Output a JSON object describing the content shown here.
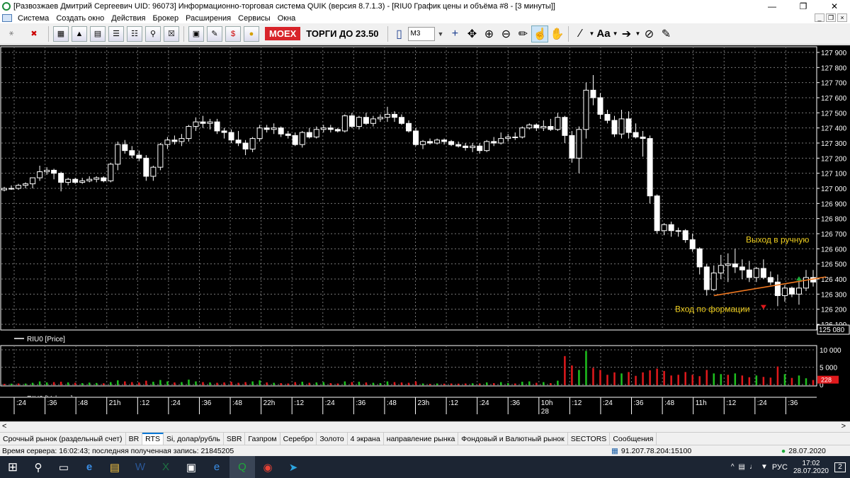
{
  "window": {
    "title": "[Развозжаев Дмитрий Сергеевич UID: 96073] Информационно-торговая система QUIK (версия 8.7.1.3) - [RIU0 График цены и объёма #8 - [3 минуты]]"
  },
  "menu": [
    "Система",
    "Создать окно",
    "Действия",
    "Брокер",
    "Расширения",
    "Сервисы",
    "Окна"
  ],
  "toolbar": {
    "exchange": "MOEX",
    "session": "ТОРГИ ДО 23.50",
    "interval": "M3",
    "font_btn": "Aa"
  },
  "price_axis": {
    "labels": [
      "127 900",
      "127 800",
      "127 700",
      "127 600",
      "127 500",
      "127 400",
      "127 300",
      "127 200",
      "127 100",
      "127 000",
      "126 900",
      "126 800",
      "126 700",
      "126 600",
      "126 500",
      "126 400",
      "126 300",
      "126 200",
      "126 100"
    ],
    "last_price": "125 080"
  },
  "volume_axis": {
    "labels": [
      "10 000",
      "5 000",
      "0"
    ],
    "last_volume": "228"
  },
  "legends": {
    "price": "RIU0 [Price]",
    "volume": "RIU0 [Volume]"
  },
  "annotations": {
    "exit": "Выход в ручную",
    "entry": "Вход по формации"
  },
  "time_axis": {
    "labels": [
      ":24",
      ":36",
      ":48",
      "21h",
      ":12",
      ":24",
      ":36",
      ":48",
      "22h",
      ":12",
      ":24",
      ":36",
      ":48",
      "23h",
      ":12",
      ":24",
      ":36",
      "10h",
      ":12",
      ":24",
      ":36",
      ":48",
      "11h",
      ":12",
      ":24",
      ":36"
    ],
    "day": "28"
  },
  "chart_data": {
    "type": "candlestick",
    "interval": "3 минуты",
    "instrument": "RIU0",
    "ylim": [
      126100,
      127900
    ],
    "candles": [
      [
        126990,
        127010,
        126980,
        127000
      ],
      [
        127000,
        127020,
        126990,
        127000
      ],
      [
        127000,
        127030,
        126990,
        127020
      ],
      [
        127020,
        127040,
        127000,
        127030
      ],
      [
        127030,
        127070,
        127000,
        127070
      ],
      [
        127070,
        127150,
        127050,
        127110
      ],
      [
        127110,
        127140,
        127090,
        127120
      ],
      [
        127120,
        127130,
        127060,
        127100
      ],
      [
        127100,
        127110,
        126980,
        127040
      ],
      [
        127040,
        127070,
        127020,
        127060
      ],
      [
        127060,
        127070,
        127030,
        127040
      ],
      [
        127040,
        127070,
        127030,
        127050
      ],
      [
        127050,
        127080,
        127040,
        127060
      ],
      [
        127060,
        127080,
        127040,
        127070
      ],
      [
        127070,
        127080,
        127040,
        127050
      ],
      [
        127050,
        127170,
        127040,
        127160
      ],
      [
        127160,
        127310,
        127120,
        127290
      ],
      [
        127290,
        127320,
        127230,
        127250
      ],
      [
        127250,
        127280,
        127200,
        127220
      ],
      [
        127220,
        127250,
        127180,
        127200
      ],
      [
        127200,
        127220,
        127050,
        127080
      ],
      [
        127080,
        127150,
        127050,
        127140
      ],
      [
        127140,
        127300,
        127120,
        127290
      ],
      [
        127290,
        127340,
        127260,
        127320
      ],
      [
        127320,
        127350,
        127290,
        127310
      ],
      [
        127310,
        127360,
        127280,
        127330
      ],
      [
        127330,
        127420,
        127310,
        127410
      ],
      [
        127410,
        127470,
        127380,
        127440
      ],
      [
        127440,
        127480,
        127400,
        127430
      ],
      [
        127430,
        127460,
        127390,
        127440
      ],
      [
        127440,
        127460,
        127360,
        127380
      ],
      [
        127380,
        127400,
        127330,
        127370
      ],
      [
        127370,
        127390,
        127300,
        127320
      ],
      [
        127320,
        127380,
        127280,
        127300
      ],
      [
        127300,
        127320,
        127220,
        127260
      ],
      [
        127260,
        127340,
        127240,
        127330
      ],
      [
        127330,
        127420,
        127310,
        127400
      ],
      [
        127400,
        127420,
        127370,
        127390
      ],
      [
        127390,
        127430,
        127360,
        127400
      ],
      [
        127400,
        127410,
        127340,
        127360
      ],
      [
        127360,
        127380,
        127330,
        127350
      ],
      [
        127350,
        127370,
        127280,
        127290
      ],
      [
        127290,
        127380,
        127270,
        127370
      ],
      [
        127370,
        127400,
        127330,
        127340
      ],
      [
        127340,
        127410,
        127330,
        127390
      ],
      [
        127390,
        127420,
        127370,
        127400
      ],
      [
        127400,
        127420,
        127370,
        127390
      ],
      [
        127390,
        127400,
        127370,
        127380
      ],
      [
        127380,
        127490,
        127370,
        127480
      ],
      [
        127480,
        127500,
        127400,
        127410
      ],
      [
        127410,
        127480,
        127390,
        127470
      ],
      [
        127470,
        127500,
        127420,
        127430
      ],
      [
        127430,
        127480,
        127410,
        127460
      ],
      [
        127460,
        127490,
        127440,
        127470
      ],
      [
        127470,
        127540,
        127440,
        127490
      ],
      [
        127490,
        127510,
        127440,
        127470
      ],
      [
        127470,
        127490,
        127420,
        127430
      ],
      [
        127430,
        127450,
        127370,
        127380
      ],
      [
        127380,
        127400,
        127280,
        127290
      ],
      [
        127290,
        127320,
        127260,
        127310
      ],
      [
        127310,
        127330,
        127290,
        127300
      ],
      [
        127300,
        127330,
        127290,
        127320
      ],
      [
        127320,
        127330,
        127290,
        127310
      ],
      [
        127310,
        127320,
        127280,
        127290
      ],
      [
        127290,
        127310,
        127270,
        127280
      ],
      [
        127280,
        127300,
        127250,
        127270
      ],
      [
        127270,
        127300,
        127240,
        127280
      ],
      [
        127280,
        127300,
        127230,
        127250
      ],
      [
        127250,
        127320,
        127240,
        127310
      ],
      [
        127310,
        127340,
        127280,
        127300
      ],
      [
        127300,
        127370,
        127290,
        127330
      ],
      [
        127330,
        127360,
        127310,
        127340
      ],
      [
        127340,
        127370,
        127320,
        127340
      ],
      [
        127340,
        127410,
        127330,
        127400
      ],
      [
        127400,
        127430,
        127390,
        127420
      ],
      [
        127420,
        127430,
        127380,
        127400
      ],
      [
        127400,
        127450,
        127380,
        127410
      ],
      [
        127410,
        127460,
        127380,
        127390
      ],
      [
        127390,
        127500,
        127380,
        127470
      ],
      [
        127470,
        127480,
        127300,
        127350
      ],
      [
        127350,
        127380,
        127170,
        127200
      ],
      [
        127200,
        127410,
        127100,
        127390
      ],
      [
        127390,
        127700,
        127330,
        127650
      ],
      [
        127650,
        127750,
        127550,
        127600
      ],
      [
        127600,
        127630,
        127460,
        127490
      ],
      [
        127490,
        127520,
        127430,
        127450
      ],
      [
        127450,
        127480,
        127340,
        127360
      ],
      [
        127360,
        127520,
        127330,
        127460
      ],
      [
        127460,
        127510,
        127330,
        127370
      ],
      [
        127370,
        127430,
        127330,
        127340
      ],
      [
        127340,
        127380,
        127210,
        127330
      ],
      [
        127330,
        127350,
        126900,
        126950
      ],
      [
        126950,
        126960,
        126700,
        126720
      ],
      [
        126720,
        126770,
        126690,
        126760
      ],
      [
        126760,
        126780,
        126680,
        126720
      ],
      [
        126720,
        126740,
        126680,
        126720
      ],
      [
        126720,
        126730,
        126640,
        126660
      ],
      [
        126660,
        126700,
        126580,
        126600
      ],
      [
        126600,
        126610,
        126430,
        126480
      ],
      [
        126480,
        126500,
        126290,
        126330
      ],
      [
        126330,
        126490,
        126320,
        126440
      ],
      [
        126440,
        126560,
        126400,
        126490
      ],
      [
        126490,
        126570,
        126380,
        126500
      ],
      [
        126500,
        126600,
        126440,
        126480
      ],
      [
        126480,
        126530,
        126400,
        126460
      ],
      [
        126460,
        126520,
        126380,
        126410
      ],
      [
        126410,
        126480,
        126380,
        126470
      ],
      [
        126470,
        126530,
        126400,
        126410
      ],
      [
        126410,
        126450,
        126360,
        126380
      ],
      [
        126380,
        126430,
        126220,
        126290
      ],
      [
        126290,
        126360,
        126250,
        126340
      ],
      [
        126340,
        126350,
        126280,
        126300
      ],
      [
        126300,
        126390,
        126230,
        126340
      ],
      [
        126340,
        126460,
        126320,
        126410
      ],
      [
        126410,
        126460,
        126350,
        126380
      ]
    ],
    "volume": [
      [
        200,
        0
      ],
      [
        250,
        1
      ],
      [
        300,
        0
      ],
      [
        280,
        1
      ],
      [
        500,
        1
      ],
      [
        900,
        1
      ],
      [
        600,
        1
      ],
      [
        700,
        0
      ],
      [
        800,
        0
      ],
      [
        600,
        1
      ],
      [
        500,
        0
      ],
      [
        400,
        1
      ],
      [
        550,
        1
      ],
      [
        450,
        1
      ],
      [
        350,
        0
      ],
      [
        700,
        1
      ],
      [
        1200,
        1
      ],
      [
        900,
        0
      ],
      [
        700,
        0
      ],
      [
        600,
        0
      ],
      [
        1100,
        0
      ],
      [
        800,
        1
      ],
      [
        1300,
        1
      ],
      [
        900,
        1
      ],
      [
        600,
        0
      ],
      [
        700,
        1
      ],
      [
        1400,
        1
      ],
      [
        900,
        1
      ],
      [
        700,
        0
      ],
      [
        600,
        1
      ],
      [
        500,
        0
      ],
      [
        600,
        0
      ],
      [
        800,
        0
      ],
      [
        500,
        0
      ],
      [
        700,
        0
      ],
      [
        900,
        1
      ],
      [
        1200,
        1
      ],
      [
        600,
        0
      ],
      [
        500,
        1
      ],
      [
        400,
        0
      ],
      [
        300,
        0
      ],
      [
        700,
        0
      ],
      [
        800,
        1
      ],
      [
        500,
        0
      ],
      [
        600,
        1
      ],
      [
        700,
        1
      ],
      [
        400,
        0
      ],
      [
        300,
        0
      ],
      [
        900,
        1
      ],
      [
        700,
        0
      ],
      [
        800,
        1
      ],
      [
        600,
        0
      ],
      [
        500,
        1
      ],
      [
        400,
        1
      ],
      [
        900,
        1
      ],
      [
        700,
        0
      ],
      [
        600,
        0
      ],
      [
        500,
        0
      ],
      [
        900,
        0
      ],
      [
        300,
        1
      ],
      [
        200,
        0
      ],
      [
        300,
        1
      ],
      [
        250,
        0
      ],
      [
        300,
        0
      ],
      [
        250,
        0
      ],
      [
        300,
        0
      ],
      [
        350,
        1
      ],
      [
        300,
        0
      ],
      [
        600,
        1
      ],
      [
        400,
        0
      ],
      [
        700,
        1
      ],
      [
        400,
        1
      ],
      [
        300,
        0
      ],
      [
        800,
        1
      ],
      [
        900,
        1
      ],
      [
        500,
        0
      ],
      [
        700,
        1
      ],
      [
        400,
        0
      ],
      [
        1100,
        1
      ],
      [
        8200,
        0
      ],
      [
        5500,
        0
      ],
      [
        4200,
        1
      ],
      [
        9700,
        1
      ],
      [
        4800,
        0
      ],
      [
        4200,
        0
      ],
      [
        2800,
        0
      ],
      [
        3500,
        0
      ],
      [
        3200,
        1
      ],
      [
        3600,
        0
      ],
      [
        2500,
        0
      ],
      [
        3500,
        0
      ],
      [
        4100,
        0
      ],
      [
        4600,
        0
      ],
      [
        3900,
        0
      ],
      [
        2600,
        0
      ],
      [
        2800,
        0
      ],
      [
        3600,
        0
      ],
      [
        2800,
        0
      ],
      [
        2400,
        0
      ],
      [
        4200,
        0
      ],
      [
        3200,
        1
      ],
      [
        3000,
        1
      ],
      [
        2800,
        0
      ],
      [
        3200,
        1
      ],
      [
        2600,
        0
      ],
      [
        2100,
        0
      ],
      [
        2600,
        1
      ],
      [
        2200,
        0
      ],
      [
        2000,
        0
      ],
      [
        5200,
        0
      ],
      [
        3000,
        1
      ],
      [
        1900,
        0
      ],
      [
        2600,
        1
      ],
      [
        1800,
        1
      ],
      [
        1300,
        0
      ]
    ],
    "trendline": {
      "from": [
        126290,
        100
      ],
      "to": [
        126400,
        114
      ]
    }
  },
  "tabs": [
    "Срочный рынок (раздельный счет)",
    "BR",
    "RTS",
    "Si, долар/рубль",
    "SBR",
    "Газпром",
    "Серебро",
    "Золото",
    "4 экрана",
    "направление рынка",
    "Фондовый и Валютный рынок",
    "SECTORS",
    "Сообщения"
  ],
  "status": {
    "server_time": "Время сервера: 16:02:43; последняя полученная запись: 21845205",
    "ip": "91.207.78.204:15100",
    "date": "28.07.2020"
  },
  "taskbar": {
    "lang": "РУС",
    "time": "17:02",
    "date": "28.07.2020",
    "notif": "2"
  }
}
